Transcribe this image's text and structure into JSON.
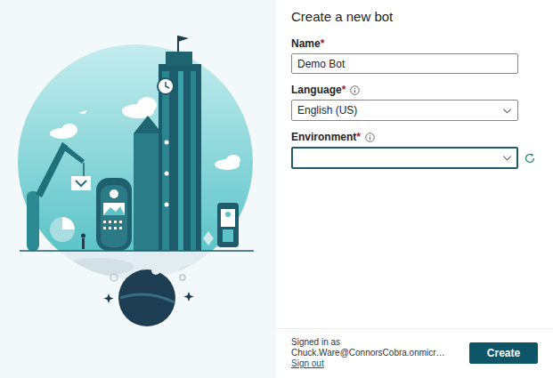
{
  "dialog": {
    "title": "Create a new bot"
  },
  "fields": [
    {
      "label": "Name",
      "required_mark": "*",
      "kind": "text",
      "value": "Demo Bot",
      "info": false,
      "focused": false,
      "refresh": false
    },
    {
      "label": "Language",
      "required_mark": "*",
      "kind": "select",
      "value": "English (US)",
      "info": true,
      "focused": false,
      "refresh": false
    },
    {
      "label": "Environment",
      "required_mark": "*",
      "kind": "select",
      "value": "",
      "info": true,
      "focused": true,
      "refresh": true
    }
  ],
  "footer": {
    "signed_in": "Signed in as Chuck.Ware@ConnorsCobra.onmicr…",
    "sign_out": "Sign out"
  },
  "buttons": [
    "Create"
  ]
}
